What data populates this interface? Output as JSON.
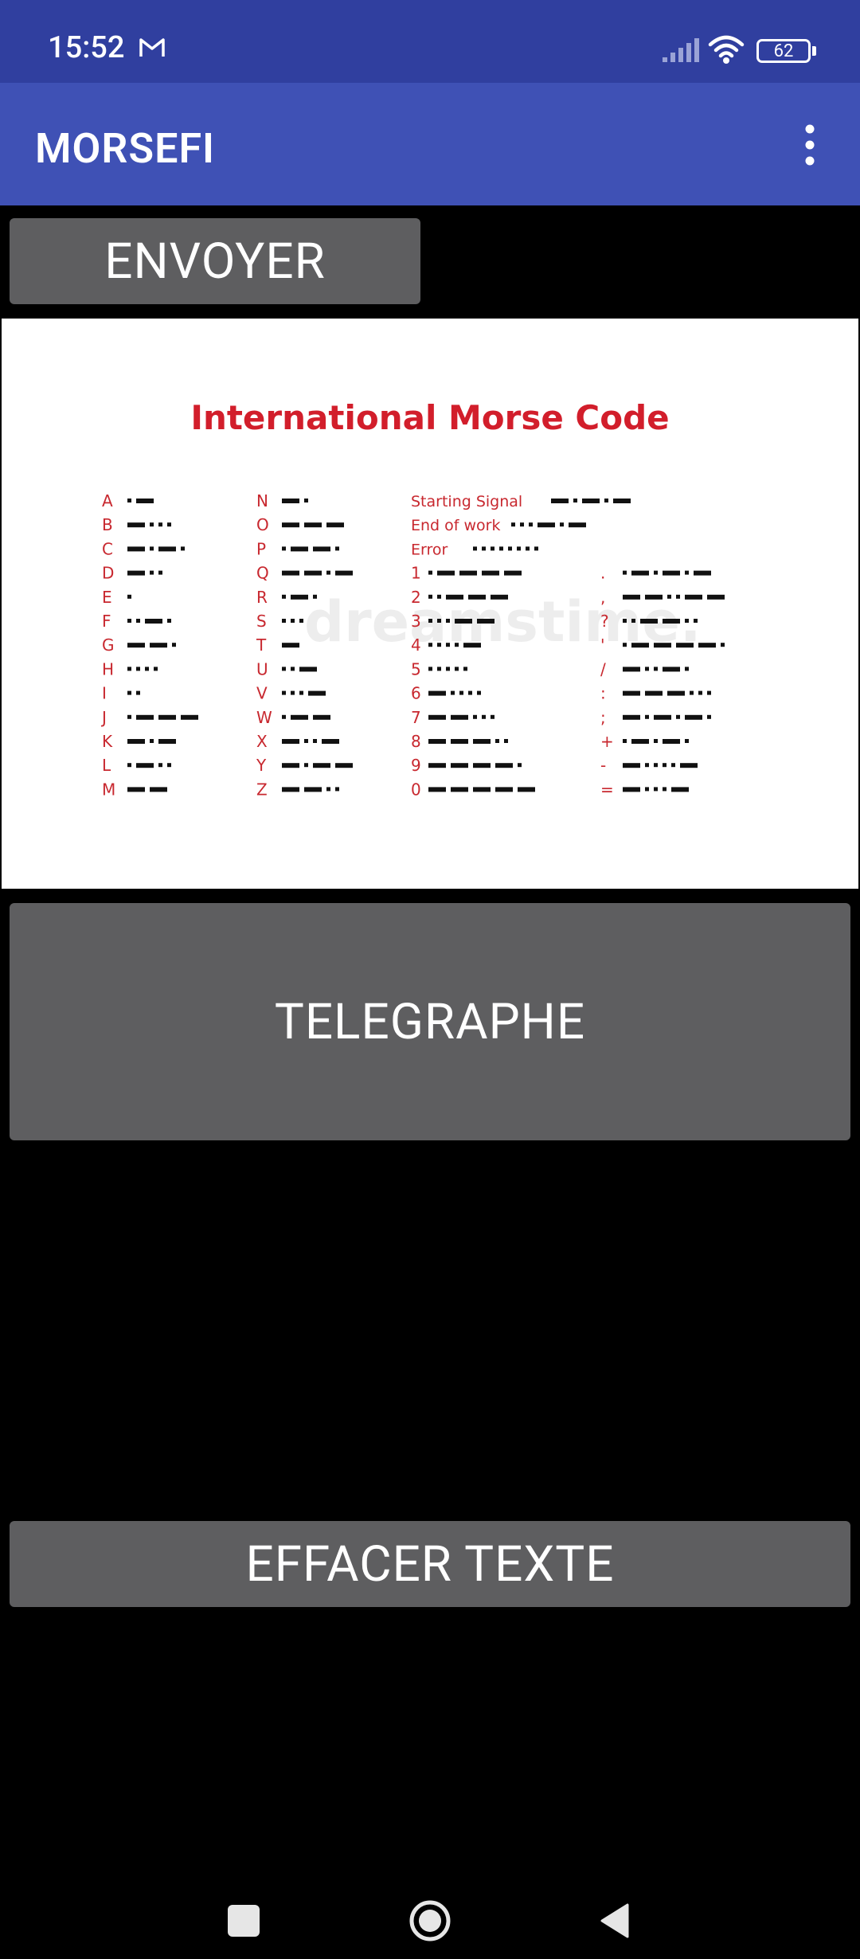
{
  "status": {
    "time": "15:52",
    "battery": "62"
  },
  "app": {
    "title": "MORSEFI"
  },
  "buttons": {
    "send": "ENVOYER",
    "telegraph": "TELEGRAPHE",
    "clear": "EFFACER TEXTE"
  },
  "chart_image": {
    "title": "International Morse Code",
    "watermark": "dreamstime.",
    "col1": [
      {
        "label": "A",
        "code": ".-"
      },
      {
        "label": "B",
        "code": "-..."
      },
      {
        "label": "C",
        "code": "-.-."
      },
      {
        "label": "D",
        "code": "-.."
      },
      {
        "label": "E",
        "code": "."
      },
      {
        "label": "F",
        "code": "..-."
      },
      {
        "label": "G",
        "code": "--."
      },
      {
        "label": "H",
        "code": "...."
      },
      {
        "label": "I",
        "code": ".."
      },
      {
        "label": "J",
        "code": ".---"
      },
      {
        "label": "K",
        "code": "-.-"
      },
      {
        "label": "L",
        "code": ".-.."
      },
      {
        "label": "M",
        "code": "--"
      }
    ],
    "col2": [
      {
        "label": "N",
        "code": "-."
      },
      {
        "label": "O",
        "code": "---"
      },
      {
        "label": "P",
        "code": ".--."
      },
      {
        "label": "Q",
        "code": "--.-"
      },
      {
        "label": "R",
        "code": ".-."
      },
      {
        "label": "S",
        "code": "..."
      },
      {
        "label": "T",
        "code": "-"
      },
      {
        "label": "U",
        "code": "..-"
      },
      {
        "label": "V",
        "code": "...-"
      },
      {
        "label": "W",
        "code": ".--"
      },
      {
        "label": "X",
        "code": "-..-"
      },
      {
        "label": "Y",
        "code": "-.--"
      },
      {
        "label": "Z",
        "code": "--.."
      }
    ],
    "signals": [
      {
        "label": "Starting Signal",
        "code": "-.-.-"
      },
      {
        "label": "End of work",
        "code": "...-.-"
      },
      {
        "label": "Error",
        "code": "........"
      }
    ],
    "col3": [
      {
        "label": "1",
        "code": ".----"
      },
      {
        "label": "2",
        "code": "..---"
      },
      {
        "label": "3",
        "code": "...--"
      },
      {
        "label": "4",
        "code": "....-"
      },
      {
        "label": "5",
        "code": "....."
      },
      {
        "label": "6",
        "code": "-...."
      },
      {
        "label": "7",
        "code": "--..."
      },
      {
        "label": "8",
        "code": "---.."
      },
      {
        "label": "9",
        "code": "----."
      },
      {
        "label": "0",
        "code": "-----"
      }
    ],
    "col4": [
      {
        "label": ".",
        "code": ".-.-.-"
      },
      {
        "label": ",",
        "code": "--..--"
      },
      {
        "label": "?",
        "code": "..--.."
      },
      {
        "label": "'",
        "code": ".----."
      },
      {
        "label": "/",
        "code": "-..-."
      },
      {
        "label": ":",
        "code": "---..."
      },
      {
        "label": ";",
        "code": "-.-.-."
      },
      {
        "label": "+",
        "code": ".-.-."
      },
      {
        "label": "-",
        "code": "-....-"
      },
      {
        "label": "=",
        "code": "-...-"
      }
    ]
  }
}
